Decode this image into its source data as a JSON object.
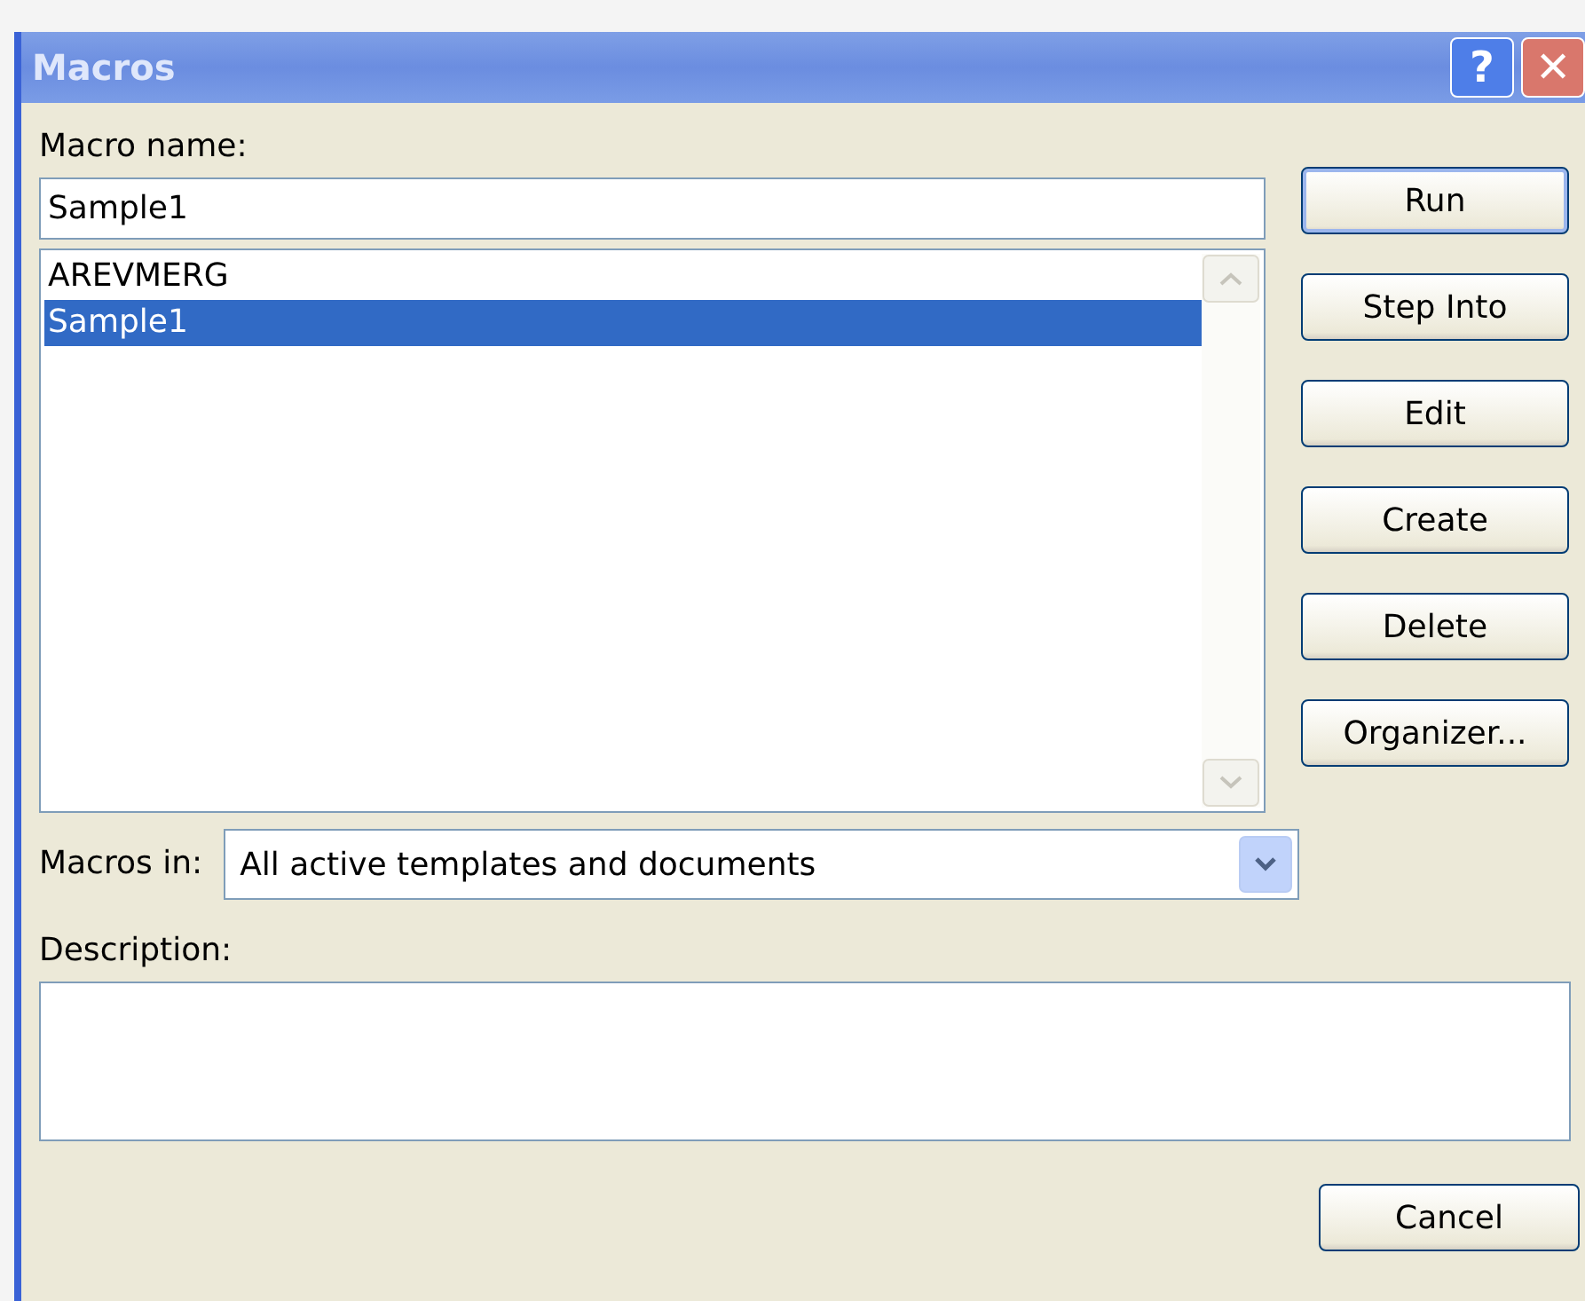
{
  "window": {
    "title": "Macros",
    "help_button": "?",
    "close_button": "✕"
  },
  "macro_name": {
    "label": "Macro name:",
    "value": "Sample1"
  },
  "macro_list": [
    {
      "name": "AREVMERG",
      "selected": false
    },
    {
      "name": "Sample1",
      "selected": true
    }
  ],
  "buttons": [
    {
      "label": "Run",
      "default": true
    },
    {
      "label": "Step Into",
      "default": false
    },
    {
      "label": "Edit",
      "default": false
    },
    {
      "label": "Create",
      "default": false
    },
    {
      "label": "Delete",
      "default": false
    },
    {
      "label": "Organizer...",
      "default": false
    }
  ],
  "macros_in": {
    "label": "Macros in:",
    "value": "All active templates and documents"
  },
  "description": {
    "label": "Description:"
  },
  "cancel_button": {
    "label": "Cancel"
  }
}
